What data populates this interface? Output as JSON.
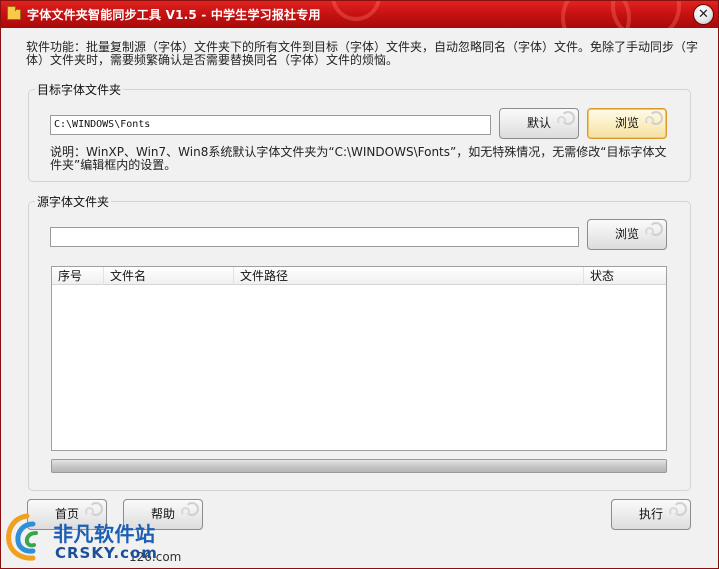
{
  "window": {
    "title": "字体文件夹智能同步工具 V1.5 - 中学生学习报社专用",
    "close_glyph": "✕",
    "colors": {
      "titlebar": "#c81212",
      "accent_button": "#f4e0a2",
      "watermark": "#1d5fb3"
    }
  },
  "description": "软件功能：批量复制源（字体）文件夹下的所有文件到目标（字体）文件夹，自动忽略同名（字体）文件。免除了手动同步（字体）文件夹时，需要频繁确认是否需要替换同名（字体）文件的烦恼。",
  "target_group": {
    "legend": "目标字体文件夹",
    "path_value": "C:\\WINDOWS\\Fonts",
    "default_button": "默认",
    "browse_button": "浏览",
    "note": "说明：WinXP、Win7、Win8系统默认字体文件夹为“C:\\WINDOWS\\Fonts”，如无特殊情况，无需修改“目标字体文件夹”编辑框内的设置。"
  },
  "source_group": {
    "legend": "源字体文件夹",
    "path_value": "",
    "browse_button": "浏览",
    "columns": [
      "序号",
      "文件名",
      "文件路径",
      "状态"
    ],
    "rows": [],
    "progress_percent": 0
  },
  "bottom": {
    "home_button": "首页",
    "help_button": "帮助",
    "execute_button": "执行",
    "footer_text": "126.com"
  },
  "watermark": {
    "cn": "非凡软件站",
    "en": "CRSKY.com"
  },
  "icons": {
    "title_icon": "folder-icon",
    "close_icon": "close-icon",
    "watermark_logo": "swirl-logo-icon"
  }
}
